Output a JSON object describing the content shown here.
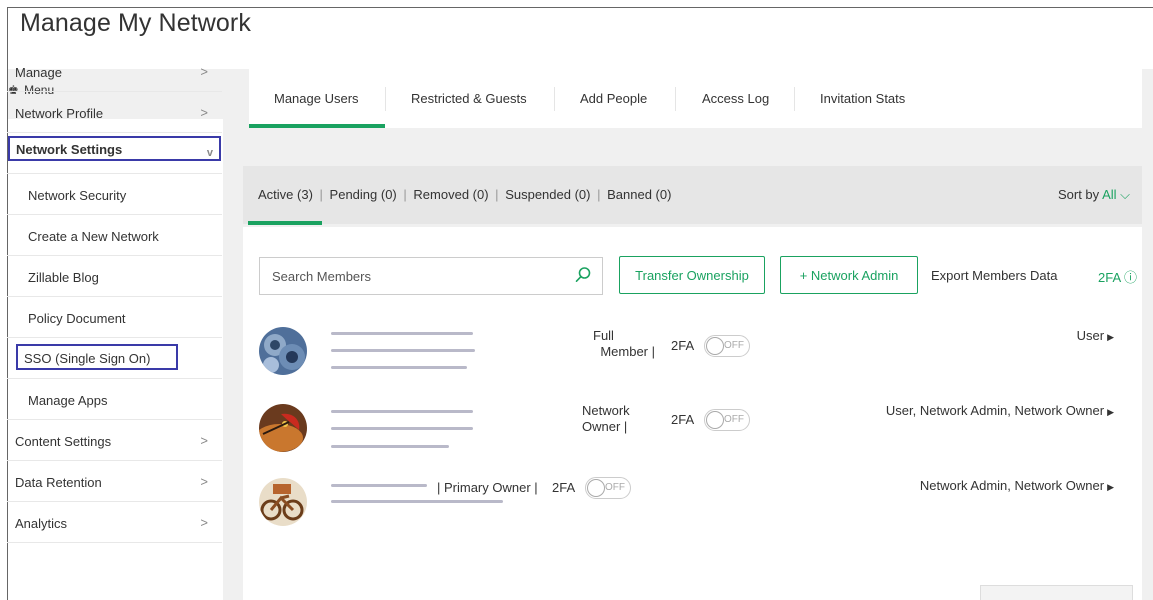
{
  "page": {
    "title": "Manage My Network"
  },
  "sidebar": {
    "menu_label": "Menu",
    "items": [
      {
        "label": "Manage",
        "has_chevron": true
      },
      {
        "label": "Network Profile",
        "has_chevron": true
      },
      {
        "label": "Network Settings",
        "expanded": true
      },
      {
        "label": "Network Security"
      },
      {
        "label": "Create a New Network"
      },
      {
        "label": "Zillable Blog"
      },
      {
        "label": "Policy Document"
      },
      {
        "label": "SSO (Single Sign On)"
      },
      {
        "label": "Manage Apps"
      },
      {
        "label": "Content Settings",
        "has_chevron": true
      },
      {
        "label": "Data Retention",
        "has_chevron": true
      },
      {
        "label": "Analytics",
        "has_chevron": true
      }
    ],
    "chevron_right": ">",
    "chevron_down": "v"
  },
  "tabs": [
    {
      "label": "Manage Users",
      "active": true
    },
    {
      "label": "Restricted & Guests"
    },
    {
      "label": "Add People"
    },
    {
      "label": "Access Log"
    },
    {
      "label": "Invitation Stats"
    }
  ],
  "status_filters": {
    "active": "Active (3)",
    "pending": "Pending (0)",
    "removed": "Removed (0)",
    "suspended": "Suspended (0)",
    "banned": "Banned (0)",
    "separator": "|",
    "sort_label": "Sort by",
    "sort_value": "All",
    "sort_chevron": "⌵"
  },
  "toolbar": {
    "search_placeholder": "Search Members",
    "transfer_button": "Transfer Ownership",
    "network_admin_button": "+ Network Admin",
    "export_link": "Export Members Data",
    "twofa_link": "2FA ⓘ"
  },
  "members": [
    {
      "membership_line1": "Full",
      "membership_line2": "Member |",
      "twofa_label": "2FA",
      "toggle_state": "OFF",
      "roles": "User"
    },
    {
      "membership_line1": "Network",
      "membership_line2": "Owner |",
      "twofa_label": "2FA",
      "toggle_state": "OFF",
      "roles": "User, Network Admin, Network Owner"
    },
    {
      "membership_inline": "| Primary Owner |",
      "twofa_label": "2FA",
      "toggle_state": "OFF",
      "roles": "Network Admin, Network Owner"
    }
  ],
  "colors": {
    "accent_green": "#1aa260",
    "highlight_box": "#3a3aa8",
    "panel_gray": "#f0f0f0"
  },
  "icons": {
    "menu": "house-icon",
    "search": "search-icon",
    "role_expand": "triangle-right-icon"
  }
}
